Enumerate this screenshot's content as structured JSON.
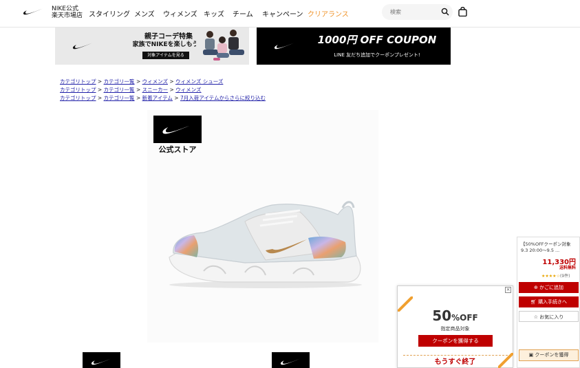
{
  "header": {
    "store_name_line1": "NIKE公式",
    "store_name_line2": "楽天市場店",
    "nav": [
      "スタイリング",
      "メンズ",
      "ウィメンズ",
      "キッズ",
      "チーム",
      "キャンペーン",
      "クリアランス"
    ],
    "search_placeholder": "検索"
  },
  "banners": {
    "family_title": "親子コーデ特集",
    "family_sub": "家族でNIKEを楽しもう！",
    "family_button": "対象アイテムを見る",
    "coupon_title": "1000円 OFF COUPON",
    "coupon_sub": "LINE 友だち追加でクーポンプレゼント!"
  },
  "breadcrumbs": [
    [
      "カテゴリトップ",
      "カテゴリ一覧",
      "ウィメンズ",
      "ウィメンズ シューズ"
    ],
    [
      "カテゴリトップ",
      "カテゴリ一覧",
      "スニーカー",
      "ウィメンズ"
    ],
    [
      "カテゴリトップ",
      "カテゴリ一覧",
      "新着アイテム",
      "7月入荷アイテムからさらに絞り込む"
    ]
  ],
  "product": {
    "official_store_label": "公式ストア"
  },
  "popup": {
    "close": "×",
    "discount_num": "50",
    "discount_unit": "%OFF",
    "sub": "指定商品対象",
    "button": "クーポンを獲得する",
    "soon": "もうすぐ終了"
  },
  "side": {
    "title": "【50%OFFクーポン対象",
    "dates": "9.3 20:00～9.5 ...",
    "price": "11,330円",
    "shipping": "送料無料",
    "stars": "★★★★☆",
    "review_count": "(9件)",
    "cart_button": "かごに追加",
    "buy_button": "購入手続きへ",
    "fav_button": "お気に入り",
    "coupon_button": "クーポンを獲得"
  },
  "colors": {
    "accent_red": "#bf0000",
    "clearance_orange": "#f0942b",
    "link_blue": "#2020a8"
  }
}
